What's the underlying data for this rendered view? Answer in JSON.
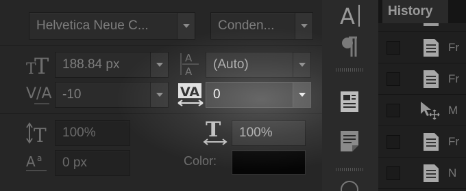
{
  "character": {
    "font_family": "Helvetica Neue C...",
    "font_style": "Conden...",
    "font_size": "188.84 px",
    "leading": "(Auto)",
    "kerning": "-10",
    "tracking": "0",
    "vertical_scale": "100%",
    "horizontal_scale": "100%",
    "baseline_shift": "0 px",
    "color_label": "Color:",
    "color_value": "#050505"
  },
  "tools": {
    "character_tool_label": "A"
  },
  "history": {
    "tab_label": "History",
    "items": [
      {
        "icon": "document-icon",
        "label": "Fr"
      },
      {
        "icon": "document-icon",
        "label": "Fr"
      },
      {
        "icon": "move-icon",
        "label": "M"
      },
      {
        "icon": "document-icon",
        "label": "Fr"
      },
      {
        "icon": "document-icon",
        "label": "N"
      }
    ]
  }
}
